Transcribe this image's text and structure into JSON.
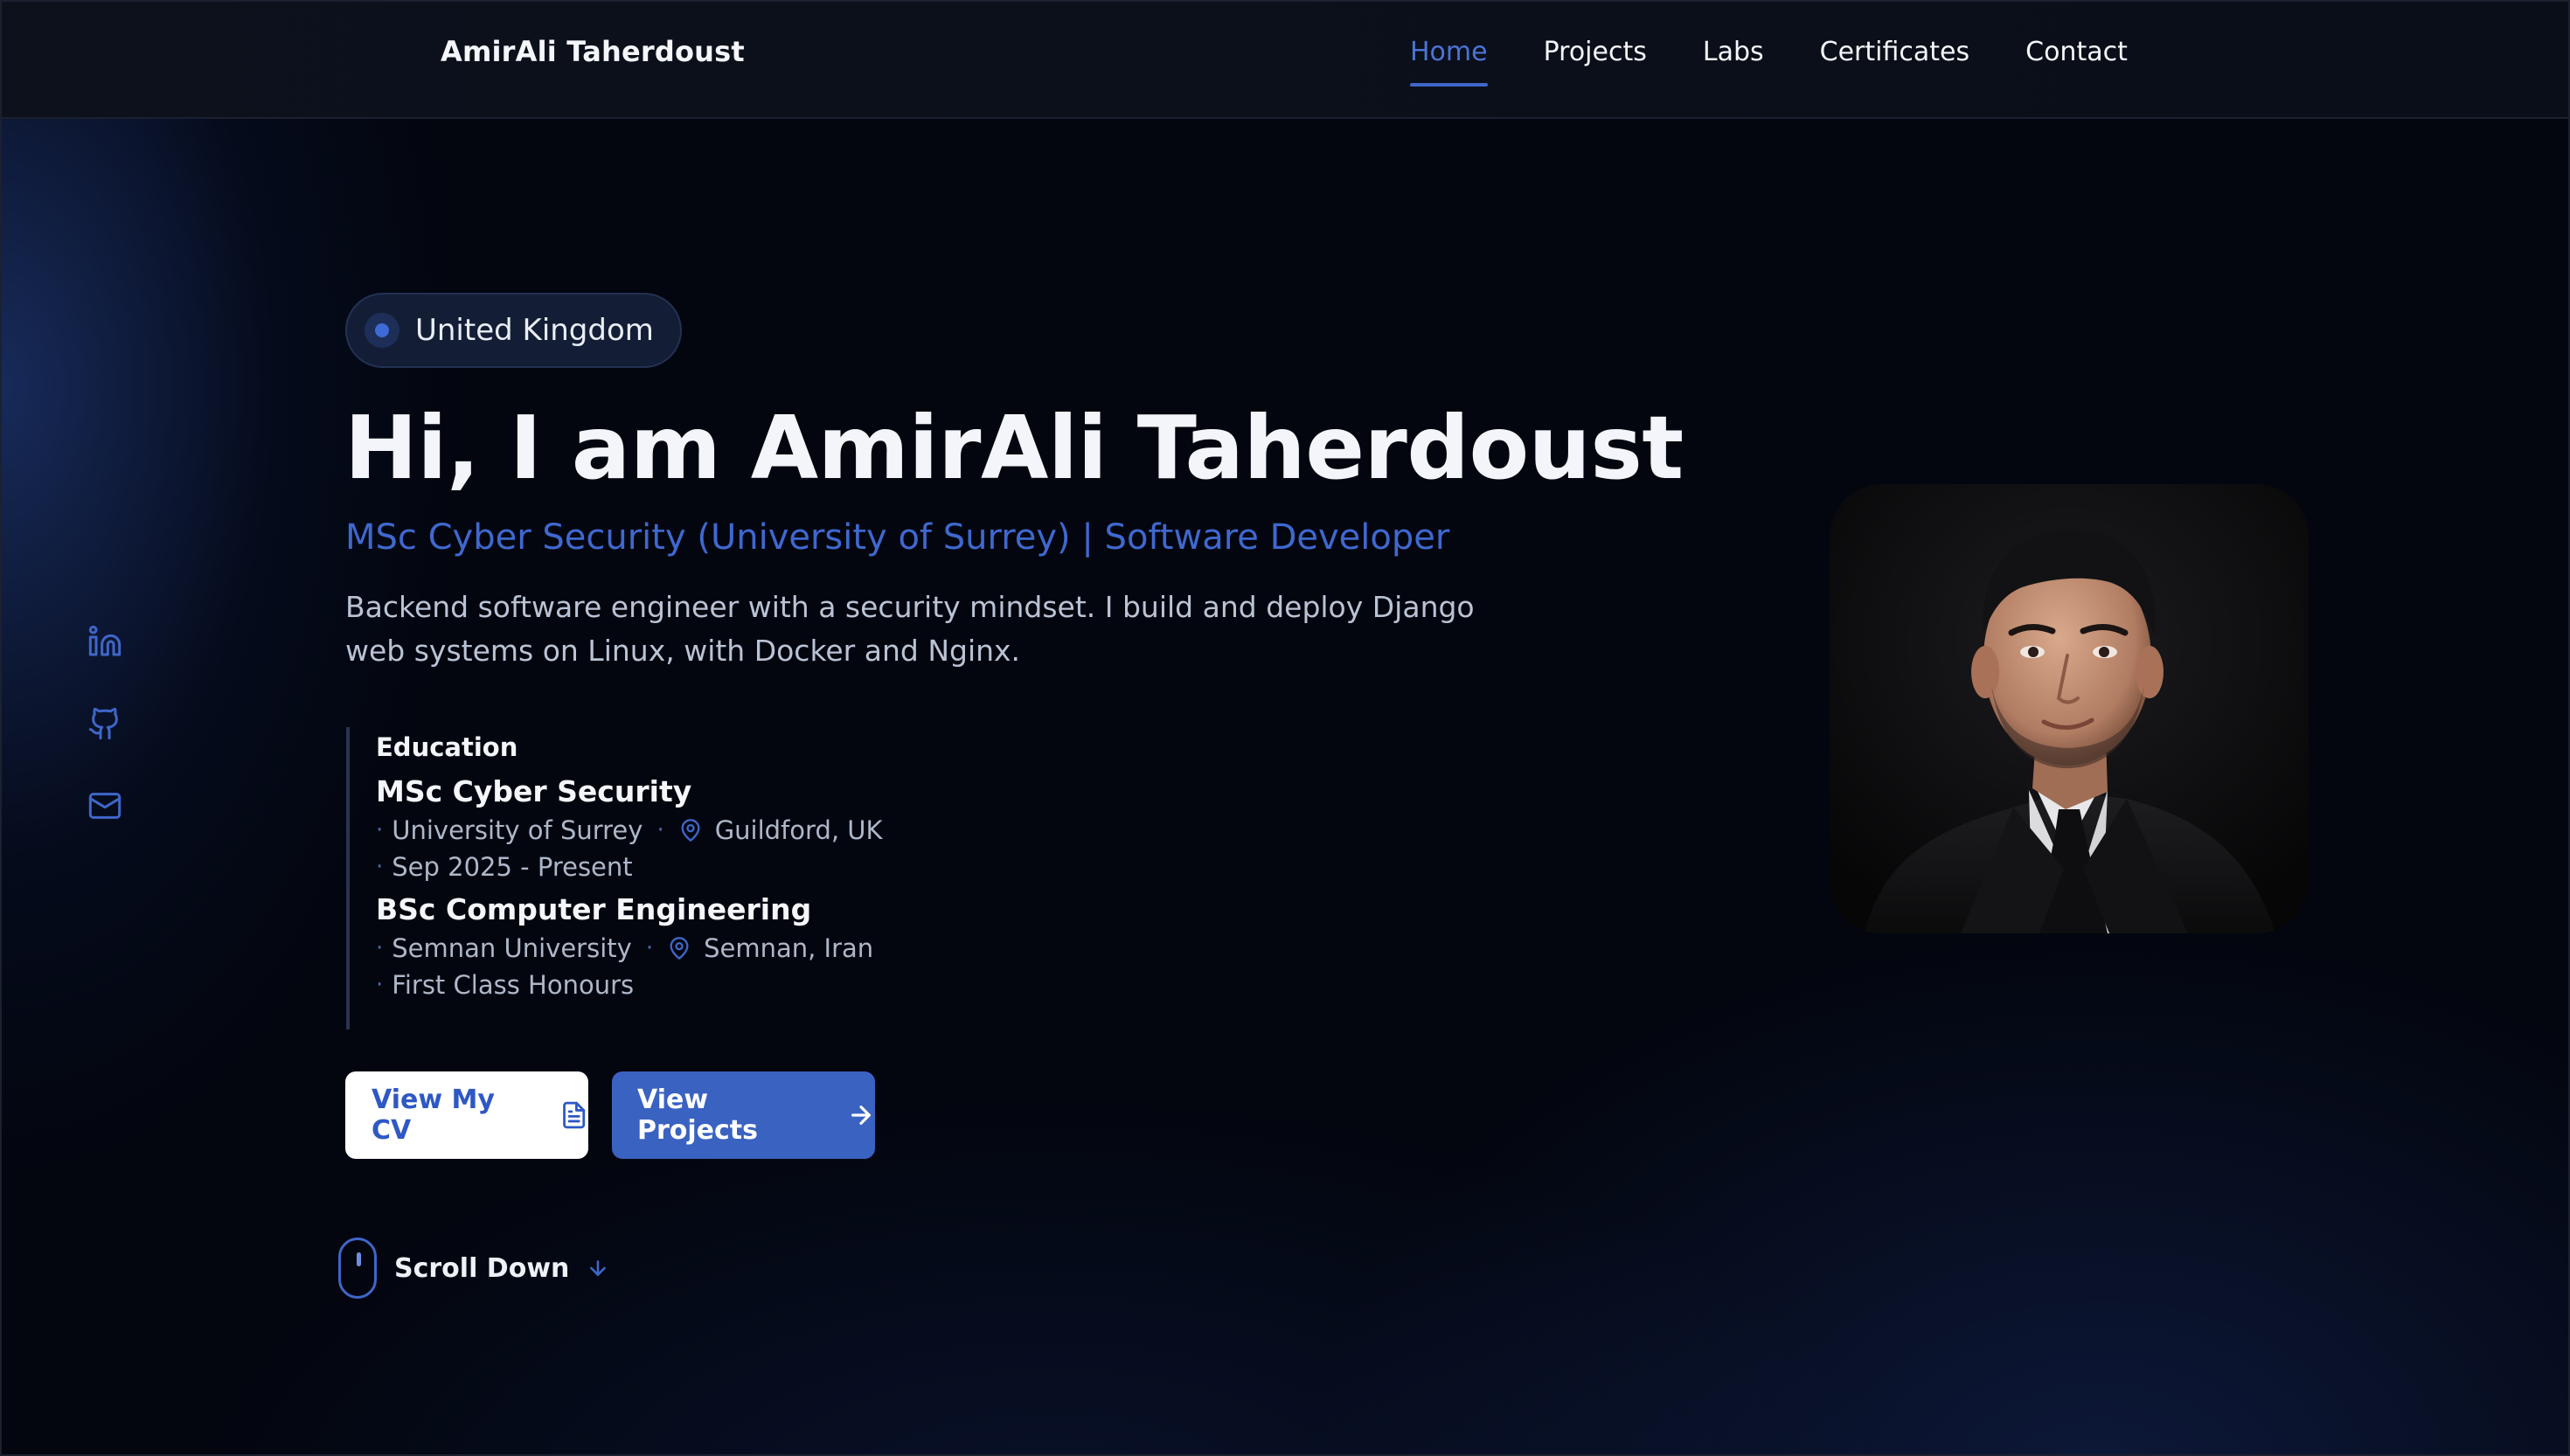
{
  "nav": {
    "brand": "AmirAli Taherdoust",
    "links": [
      {
        "label": "Home",
        "active": true
      },
      {
        "label": "Projects"
      },
      {
        "label": "Labs"
      },
      {
        "label": "Certificates"
      },
      {
        "label": "Contact"
      }
    ]
  },
  "social": [
    "linkedin-icon",
    "github-icon",
    "mail-icon"
  ],
  "hero": {
    "location": "United Kingdom",
    "title": "Hi, I am AmirAli Taherdoust",
    "subtitle": "MSc Cyber Security (University of Surrey) | Software Developer",
    "description": "Backend software engineer with a security mindset. I build and deploy Django web systems on Linux, with Docker and Nginx."
  },
  "education": {
    "heading": "Education",
    "items": [
      {
        "degree": "MSc Cyber Security",
        "institution": "University of Surrey",
        "location": "Guildford, UK",
        "detail": "Sep 2025 - Present"
      },
      {
        "degree": "BSc Computer Engineering",
        "institution": "Semnan University",
        "location": "Semnan, Iran",
        "detail": "First Class Honours"
      }
    ]
  },
  "buttons": {
    "cv": "View My CV",
    "projects": "View Projects"
  },
  "scroll": {
    "label": "Scroll Down"
  },
  "colors": {
    "accent": "#3f66c9",
    "background": "#03060f",
    "nav": "#0c101a"
  }
}
